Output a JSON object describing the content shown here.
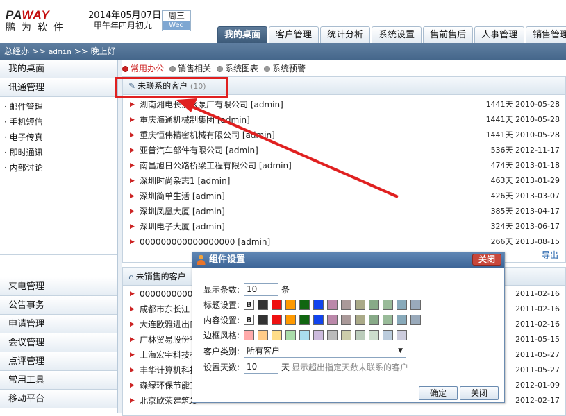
{
  "header": {
    "brand_a": "PA",
    "brand_b": "WAY",
    "brand_cn": "鹏为软件",
    "date": "2014年05月07日",
    "lunar": "甲午年四月初九",
    "weekday": "周三",
    "weekday_en": "Wed"
  },
  "tabs": [
    "我的桌面",
    "客户管理",
    "统计分析",
    "系统设置",
    "售前售后",
    "人事管理",
    "销售管理"
  ],
  "subbar": {
    "prefix": "总经办 >> ",
    "user": "admin",
    "suffix": " >> 晚上好"
  },
  "sidebar": {
    "head1": "我的桌面",
    "head2": "讯通管理",
    "items": [
      "· 邮件管理",
      "· 手机短信",
      "· 电子传真",
      "· 即时通讯",
      "· 内部讨论"
    ],
    "bottom": [
      "来电管理",
      "公告事务",
      "申请管理",
      "会议管理",
      "点评管理",
      "常用工具",
      "移动平台"
    ]
  },
  "radios": [
    "常用办公",
    "销售相关",
    "系统图表",
    "系统预警"
  ],
  "panel1": {
    "title": "未联系的客户",
    "count": "(10)",
    "export": "导出",
    "rows": [
      {
        "name": "湖南湘电长沙水泵厂有限公司 [admin]",
        "days": "1441天",
        "date": "2010-05-28"
      },
      {
        "name": "重庆海通机械制集团 [admin]",
        "days": "1441天",
        "date": "2010-05-28"
      },
      {
        "name": "重庆恒伟精密机械有限公司 [admin]",
        "days": "1441天",
        "date": "2010-05-28"
      },
      {
        "name": "亚普汽车部件有限公司 [admin]",
        "days": "536天",
        "date": "2012-11-17"
      },
      {
        "name": "南昌旭日公路桥梁工程有限公司 [admin]",
        "days": "474天",
        "date": "2013-01-18"
      },
      {
        "name": "深圳时尚杂志1 [admin]",
        "days": "463天",
        "date": "2013-01-29"
      },
      {
        "name": "深圳简单生活 [admin]",
        "days": "426天",
        "date": "2013-03-07"
      },
      {
        "name": "深圳凤凰大厦 [admin]",
        "days": "385天",
        "date": "2013-04-17"
      },
      {
        "name": "深圳电子大厦 [admin]",
        "days": "324天",
        "date": "2013-06-17"
      },
      {
        "name": "000000000000000000 [admin]",
        "days": "266天",
        "date": "2013-08-15"
      }
    ]
  },
  "panel2": {
    "title": "未销售的客户",
    "rows": [
      {
        "name": "0000000000",
        "date": "2011-02-16"
      },
      {
        "name": "成都市东长江",
        "date": "2011-02-16"
      },
      {
        "name": "大连欧雅进出口",
        "date": "2011-02-16"
      },
      {
        "name": "广林贸易股份有",
        "date": "2011-05-15"
      },
      {
        "name": "上海宏宇科技有",
        "date": "2011-05-27"
      },
      {
        "name": "丰华计算机科技",
        "date": "2011-05-27"
      },
      {
        "name": "森绿环保节能工",
        "date": "2012-01-09"
      },
      {
        "name": "北京欣荣建筑发",
        "date": "2012-02-17"
      }
    ]
  },
  "dialog": {
    "title": "组件设置",
    "close": "关闭",
    "count_label": "显示条数:",
    "count_value": "10",
    "count_unit": "条",
    "title_style_label": "标题设置:",
    "content_style_label": "内容设置:",
    "border_label": "边框风格:",
    "bold": "B",
    "category_label": "客户类别:",
    "category_value": "所有客户",
    "days_label": "设置天数:",
    "days_value": "10",
    "days_unit": "天",
    "days_hint": "显示超出指定天数未联系的客户",
    "ok": "确定",
    "cancel": "关闭",
    "text_colors": [
      "#333333",
      "#ee1111",
      "#ff9900",
      "#116611",
      "#1144ee",
      "#bb88aa",
      "#aa9999",
      "#aaaa88",
      "#88aa88",
      "#99bb99",
      "#88aabb",
      "#99aabb"
    ],
    "border_colors": [
      "#ffaaaa",
      "#ffcc88",
      "#ffdd88",
      "#aaddaa",
      "#aaddee",
      "#ccbbdd",
      "#bbbbbb",
      "#ccccaa",
      "#bbccbb",
      "#ccddcc",
      "#bbccdd",
      "#ccccdd"
    ]
  }
}
